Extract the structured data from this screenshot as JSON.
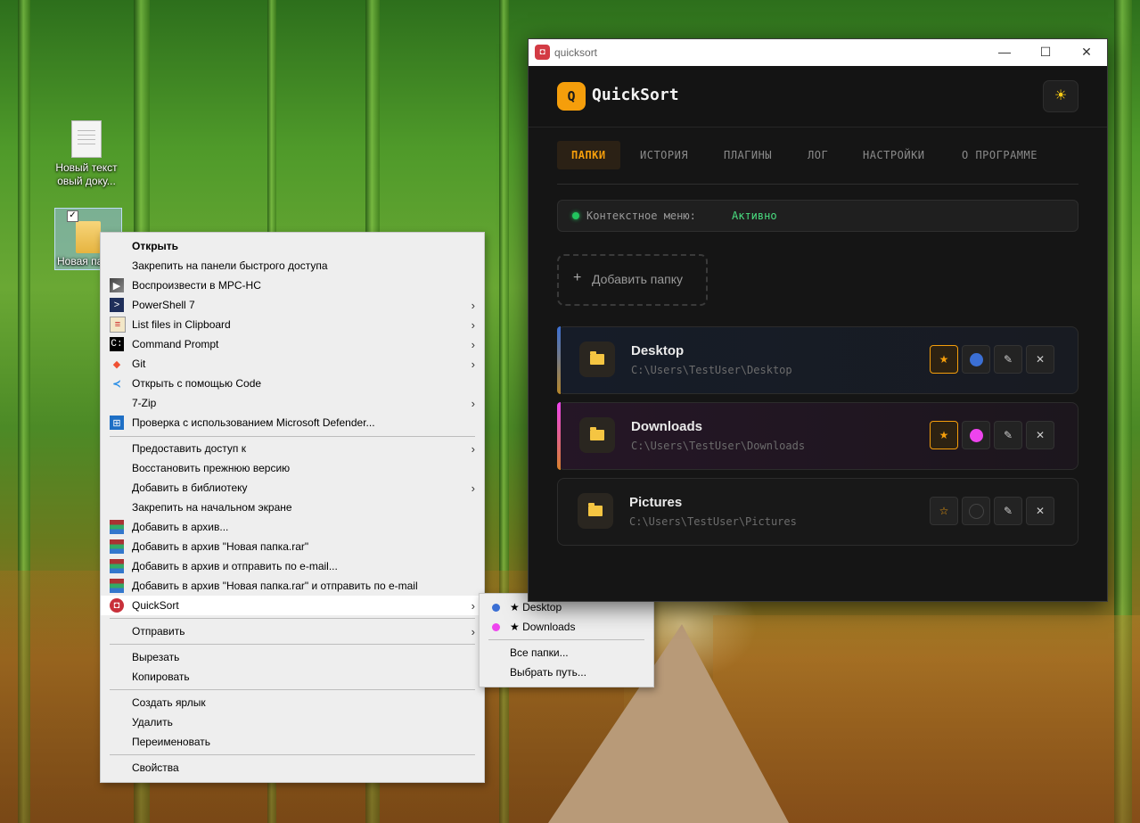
{
  "desktop": {
    "icons": [
      {
        "label": "Новый текст овый доку..."
      },
      {
        "label": "Новая па..."
      }
    ]
  },
  "context_menu": {
    "items": [
      {
        "label": "Открыть"
      },
      {
        "label": "Закрепить на панели быстрого доступа"
      },
      {
        "label": "Воспроизвести в MPC-HC"
      },
      {
        "label": "PowerShell 7"
      },
      {
        "label": "List files in Clipboard"
      },
      {
        "label": "Command Prompt"
      },
      {
        "label": "Git"
      },
      {
        "label": "Открыть с помощью Code"
      },
      {
        "label": "7-Zip"
      },
      {
        "label": "Проверка с использованием Microsoft Defender..."
      },
      {
        "label": "Предоставить доступ к"
      },
      {
        "label": "Восстановить прежнюю версию"
      },
      {
        "label": "Добавить в библиотеку"
      },
      {
        "label": "Закрепить на начальном экране"
      },
      {
        "label": "Добавить в архив..."
      },
      {
        "label": "Добавить в архив \"Новая папка.rar\""
      },
      {
        "label": "Добавить в архив и отправить по e-mail..."
      },
      {
        "label": "Добавить в архив \"Новая папка.rar\" и отправить по e-mail"
      },
      {
        "label": "QuickSort"
      },
      {
        "label": "Отправить"
      },
      {
        "label": "Вырезать"
      },
      {
        "label": "Копировать"
      },
      {
        "label": "Создать ярлык"
      },
      {
        "label": "Удалить"
      },
      {
        "label": "Переименовать"
      },
      {
        "label": "Свойства"
      }
    ]
  },
  "quicksort_submenu": {
    "items": [
      {
        "label": "★ Desktop",
        "color": "#3b6fd4"
      },
      {
        "label": "★ Downloads",
        "color": "#ee44ee"
      },
      {
        "label": "Все папки..."
      },
      {
        "label": "Выбрать путь..."
      }
    ]
  },
  "window": {
    "title": "quicksort",
    "controls": {
      "minimize": "—",
      "maximize": "☐",
      "close": "✕"
    }
  },
  "app": {
    "logo_letter": "Q",
    "name": "QuickSort",
    "theme_icon": "☀",
    "tabs": [
      {
        "label": "ПАПКИ",
        "active": true
      },
      {
        "label": "ИСТОРИЯ"
      },
      {
        "label": "ПЛАГИНЫ"
      },
      {
        "label": "ЛОГ"
      },
      {
        "label": "НАСТРОЙКИ"
      },
      {
        "label": "О ПРОГРАММЕ"
      }
    ],
    "status": {
      "label": "Контекстное меню:",
      "value": "Активно"
    },
    "add_folder": {
      "plus": "+",
      "label": "Добавить папку"
    },
    "folders": [
      {
        "name": "Desktop",
        "path": "C:\\Users\\TestUser\\Desktop",
        "color": "#3b6fd4",
        "favorite": true
      },
      {
        "name": "Downloads",
        "path": "C:\\Users\\TestUser\\Downloads",
        "color": "#ee44ee",
        "favorite": true
      },
      {
        "name": "Pictures",
        "path": "C:\\Users\\TestUser\\Pictures",
        "color": null,
        "favorite": false
      }
    ],
    "card_icons": {
      "star": "★",
      "star_outline": "☆",
      "edit": "✎",
      "remove": "✕"
    }
  },
  "colors": {
    "accent": "#f59e0b",
    "status_active": "#4ade80",
    "background": "#151515"
  }
}
